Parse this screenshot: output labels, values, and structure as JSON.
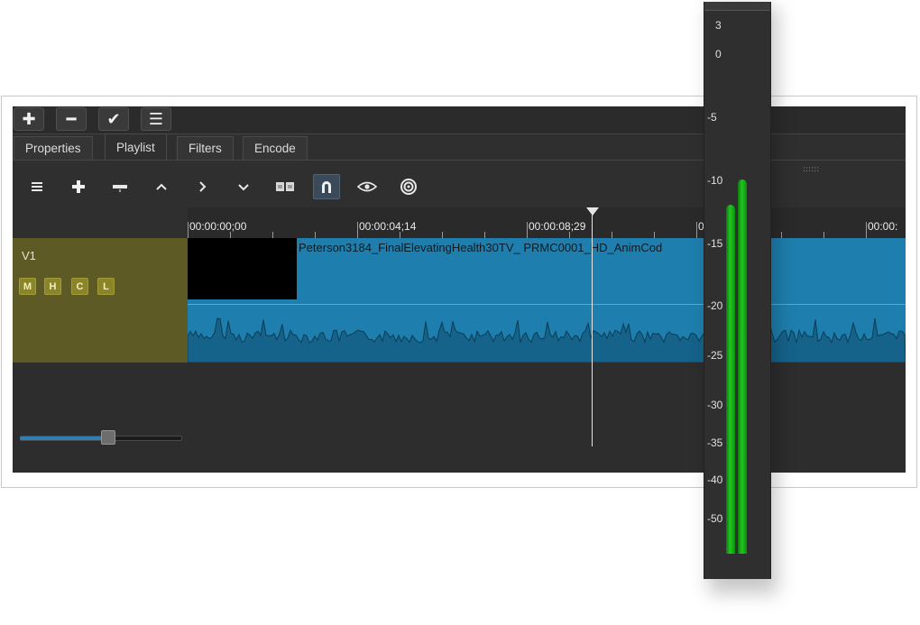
{
  "top_buttons": [
    {
      "icon": "plus-icon",
      "glyph": "✚"
    },
    {
      "icon": "minus-icon",
      "glyph": "━"
    },
    {
      "icon": "check-icon",
      "glyph": "✔"
    },
    {
      "icon": "menu-icon",
      "glyph": "☰"
    }
  ],
  "tabs": [
    {
      "label": "Properties",
      "active": false
    },
    {
      "label": "Playlist",
      "active": true
    },
    {
      "label": "Filters",
      "active": false
    },
    {
      "label": "Encode",
      "active": false
    }
  ],
  "grip": "::::::",
  "toolbar": [
    {
      "icon": "menu-icon"
    },
    {
      "icon": "append-icon"
    },
    {
      "icon": "remove-icon"
    },
    {
      "icon": "lift-icon"
    },
    {
      "icon": "overwrite-icon"
    },
    {
      "icon": "ripple-icon"
    },
    {
      "icon": "split-icon"
    },
    {
      "icon": "snap-magnet-icon",
      "active": true
    },
    {
      "icon": "scrub-eye-icon"
    },
    {
      "icon": "ripple-all-icon"
    }
  ],
  "timeline": {
    "ruler_labels": [
      "00:00:00;00",
      "00:00:04;14",
      "00:00:08;29",
      "0",
      "00:00:"
    ],
    "track": {
      "name": "V1",
      "buttons": [
        "M",
        "H",
        "C",
        "L"
      ]
    },
    "clip_name": "Peterson3184_FinalElevatingHealth30TV_ PRMC0001_HD_AnimCod",
    "zoom_level": 0.55
  },
  "audio_meter": {
    "scale_labels": [
      "3",
      "0",
      "-5",
      "-10",
      "-15",
      "-20",
      "-25",
      "-30",
      "-35",
      "-40",
      "-50"
    ],
    "channels": [
      {
        "name": "left",
        "level_db": -11
      },
      {
        "name": "right",
        "level_db": -9
      }
    ]
  },
  "colors": {
    "app_background": "#2f2f2f",
    "track_header": "#5e5a25",
    "clip": "#1e7fae",
    "meter_bar": "#21c621"
  }
}
